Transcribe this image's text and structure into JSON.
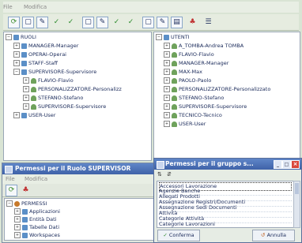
{
  "main": {
    "menu": [
      "File",
      "Modifica"
    ],
    "left_tree": {
      "root": "RUOLI",
      "items": [
        "MANAGER-Manager",
        "OPERAI-Operai",
        "STAFF-Staff",
        "SUPERVISORE-Supervisore",
        "FLAVIO-Flavio",
        "PERSONALIZZATORE-Personalizz",
        "STEFANO-Stefano",
        "SUPERVISORE-Supervisore",
        "USER-User"
      ]
    },
    "right_tree": {
      "root": "UTENTI",
      "items": [
        "A_TOMBA-Andrea TOMBA",
        "FLAVIO-Flavio",
        "MANAGER-Manager",
        "MAX-Max",
        "PAOLO-Paolo",
        "PERSONALIZZATORE-Personalizzato",
        "STEFANO-Stefano",
        "SUPERVISORE-Supervisore",
        "TECNICO-Tecnico",
        "USER-User"
      ]
    }
  },
  "permissions_window": {
    "title": "Permessi per il Ruolo SUPERVISOR",
    "menu": [
      "File",
      "Modifica"
    ],
    "tree": {
      "root": "PERMESSI",
      "items": [
        "Applicazioni",
        "Entità Dati",
        "Tabelle Dati",
        "Workspaces"
      ]
    }
  },
  "group_dialog": {
    "title": "Permessi per il gruppo s...",
    "items": [
      "Accessori Lavorazione",
      "Agenzie Banche",
      "Allegati Prodotti",
      "Assegnazione Registri/Documenti",
      "Assegnazione Sedi Documenti",
      "Attività",
      "Categorie Attività",
      "Categorie Lavorazioni"
    ],
    "confirm_label": "Conferma",
    "cancel_label": "Annulla"
  },
  "colors": {
    "titlebar": "#4a6fb5",
    "background": "#d9e4d4",
    "close_button": "#d9483b"
  }
}
